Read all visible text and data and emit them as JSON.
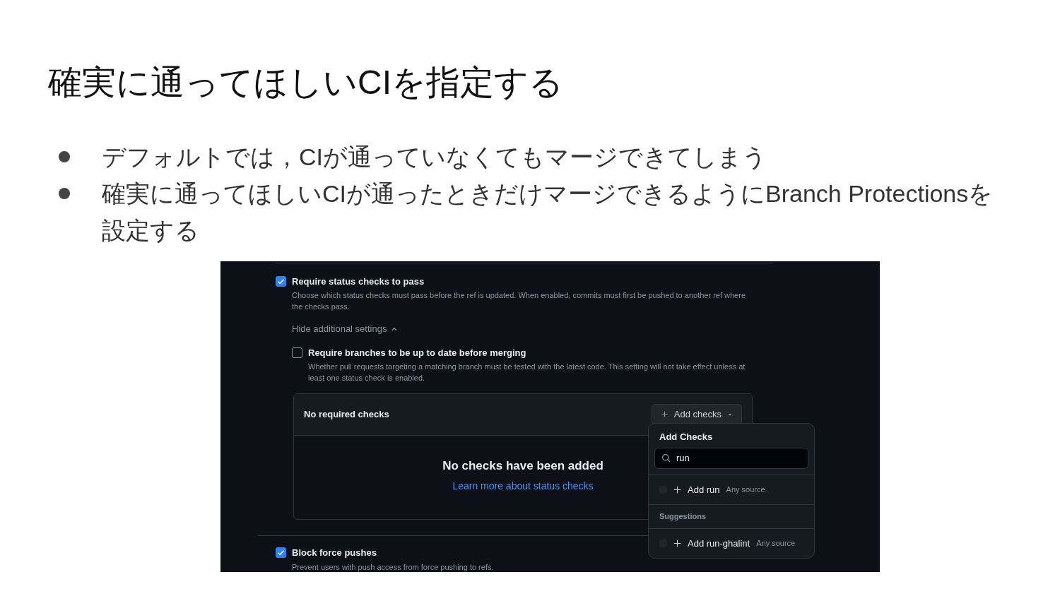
{
  "slide": {
    "title": "確実に通ってほしいCIを指定する",
    "bullets": [
      "デフォルトでは，CIが通っていなくてもマージできてしまう",
      "確実に通ってほしいCIが通ったときだけマージできるようにBranch Protectionsを設定する"
    ]
  },
  "status_checks": {
    "label": "Require status checks to pass",
    "checked": true,
    "description": "Choose which status checks must pass before the ref is updated. When enabled, commits must first be pushed to another ref where the checks pass.",
    "toggle": "Hide additional settings",
    "expanded": true,
    "sub_option": {
      "label": "Require branches to be up to date before merging",
      "checked": false,
      "description": "Whether pull requests targeting a matching branch must be tested with the latest code. This setting will not take effect unless at least one status check is enabled."
    },
    "required_checks": {
      "header": "No required checks",
      "add_button": "Add checks",
      "empty_title": "No checks have been added",
      "empty_link": "Learn more about status checks"
    }
  },
  "force_pushes": {
    "label": "Block force pushes",
    "checked": true,
    "description": "Prevent users with push access from force pushing to refs."
  },
  "dropdown": {
    "title": "Add Checks",
    "search_value": "run",
    "items": [
      {
        "kind": "option",
        "label": "Add run",
        "source": "Any source",
        "selected": false
      },
      {
        "kind": "heading",
        "label": "Suggestions"
      },
      {
        "kind": "option",
        "label": "Add run-ghalint",
        "source": "Any source",
        "selected": false
      }
    ]
  }
}
